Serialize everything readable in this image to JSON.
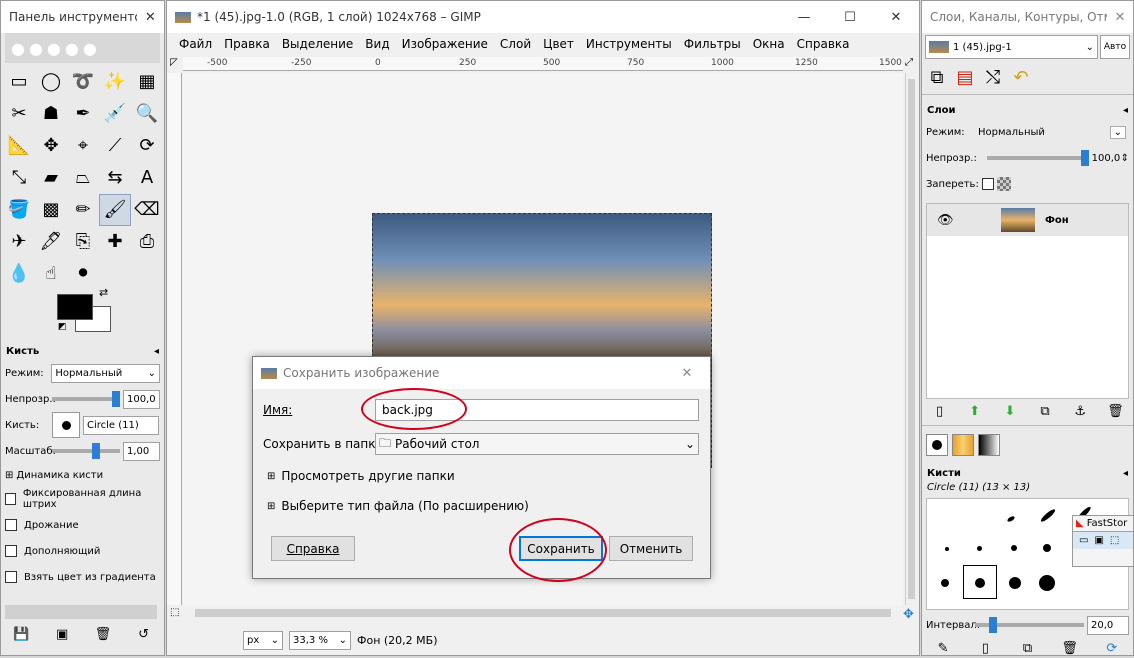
{
  "toolbox": {
    "title": "Панель инструментов",
    "tools": [
      {
        "name": "rect-select-icon",
        "glyph": "▭"
      },
      {
        "name": "ellipse-select-icon",
        "glyph": "◯"
      },
      {
        "name": "free-select-icon",
        "glyph": "➰"
      },
      {
        "name": "fuzzy-select-icon",
        "glyph": "✨"
      },
      {
        "name": "color-select-icon",
        "glyph": "▦"
      },
      {
        "name": "scissors-icon",
        "glyph": "✂"
      },
      {
        "name": "foreground-select-icon",
        "glyph": "☗"
      },
      {
        "name": "paths-icon",
        "glyph": "✒"
      },
      {
        "name": "color-picker-icon",
        "glyph": "💉"
      },
      {
        "name": "zoom-icon",
        "glyph": "🔍"
      },
      {
        "name": "measure-icon",
        "glyph": "📐"
      },
      {
        "name": "move-icon",
        "glyph": "✥"
      },
      {
        "name": "align-icon",
        "glyph": "⌖"
      },
      {
        "name": "crop-icon",
        "glyph": "⟋"
      },
      {
        "name": "rotate-icon",
        "glyph": "⟳"
      },
      {
        "name": "scale-icon",
        "glyph": "⤡"
      },
      {
        "name": "shear-icon",
        "glyph": "▰"
      },
      {
        "name": "perspective-icon",
        "glyph": "⏢"
      },
      {
        "name": "flip-icon",
        "glyph": "⇆"
      },
      {
        "name": "text-icon",
        "glyph": "A"
      },
      {
        "name": "bucket-fill-icon",
        "glyph": "🪣"
      },
      {
        "name": "gradient-icon",
        "glyph": "▩"
      },
      {
        "name": "pencil-icon",
        "glyph": "✏"
      },
      {
        "name": "paintbrush-icon",
        "glyph": "🖌"
      },
      {
        "name": "eraser-icon",
        "glyph": "⌫"
      },
      {
        "name": "airbrush-icon",
        "glyph": "✈"
      },
      {
        "name": "ink-icon",
        "glyph": "🖋"
      },
      {
        "name": "clone-icon",
        "glyph": "⎘"
      },
      {
        "name": "heal-icon",
        "glyph": "✚"
      },
      {
        "name": "perspective-clone-icon",
        "glyph": "⎙"
      },
      {
        "name": "blur-icon",
        "glyph": "💧"
      },
      {
        "name": "smudge-icon",
        "glyph": "☝"
      },
      {
        "name": "dodge-burn-icon",
        "glyph": "⚫"
      }
    ],
    "fg_color": "#000000",
    "bg_color": "#ffffff",
    "brush_panel": {
      "title": "Кисть",
      "mode_label": "Режим:",
      "mode_value": "Нормальный",
      "opacity_label": "Непрозр.:",
      "opacity_value": "100,0",
      "brush_label": "Кисть:",
      "brush_value": "Circle (11)",
      "scale_label": "Масштаб:",
      "scale_value": "1,00",
      "dynamics_label": "Динамика кисти",
      "options": [
        "Фиксированная длина штрих",
        "Дрожание",
        "Дополняющий",
        "Взять цвет из градиента"
      ]
    }
  },
  "main": {
    "title": "*1 (45).jpg-1.0 (RGB, 1 слой) 1024x768 – GIMP",
    "menu": [
      "Файл",
      "Правка",
      "Выделение",
      "Вид",
      "Изображение",
      "Слой",
      "Цвет",
      "Инструменты",
      "Фильтры",
      "Окна",
      "Справка"
    ],
    "ruler_labels": [
      "-500",
      "-250",
      "0",
      "250",
      "500",
      "750",
      "1000",
      "1250",
      "1500"
    ],
    "status": {
      "unit": "px",
      "zoom": "33,3 %",
      "info": "Фон (20,2 МБ)"
    }
  },
  "dialog": {
    "title": "Сохранить изображение",
    "name_label": "Имя:",
    "name_value": "back.jpg",
    "folder_label": "Сохранить в папке",
    "folder_value": "Рабочий стол",
    "browse_label": "Просмотреть другие папки",
    "filetype_label": "Выберите тип файла (По расширению)",
    "help_button": "Справка",
    "save_button": "Сохранить",
    "cancel_button": "Отменить"
  },
  "dock": {
    "title": "Слои, Каналы, Контуры, Отме...",
    "image_select": "1 (45).jpg-1",
    "auto_button": "Авто",
    "layers_title": "Слои",
    "mode_label": "Режим:",
    "mode_value": "Нормальный",
    "opacity_label": "Непрозр.:",
    "opacity_value": "100,0",
    "lock_label": "Запереть:",
    "layer_name": "Фон",
    "brushes_title": "Кисти",
    "brush_info": "Circle (11) (13 × 13)",
    "interval_label": "Интервал:",
    "interval_value": "20,0",
    "popup_label": "FastStor"
  },
  "colors": {
    "accent": "#2a7fd4",
    "highlight": "#d2001c"
  }
}
